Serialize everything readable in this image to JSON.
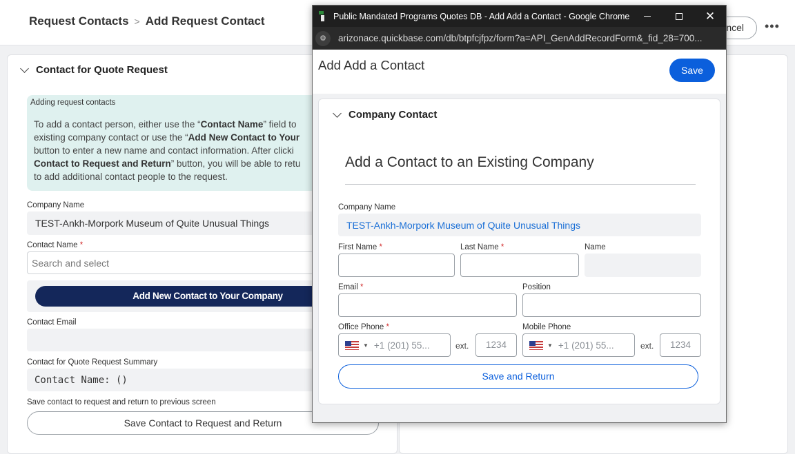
{
  "breadcrumb": {
    "parent": "Request Contacts",
    "separator": ">",
    "current": "Add Request Contact"
  },
  "header_actions": {
    "cancel_label": "ncel",
    "more_label": "•••"
  },
  "left": {
    "section_title": "Contact for Quote Request",
    "info_title": "Adding request contacts",
    "info_lines": [
      [
        "To add a contact person, either use the “",
        "Contact Name",
        "” field to"
      ],
      [
        "existing company contact or use the “",
        "Add New Contact to Your",
        ""
      ],
      [
        "button to enter a new name and contact information. After clicki",
        "",
        ""
      ],
      [
        "",
        "Contact to Request and Return",
        "” button, you will be able to retu"
      ],
      [
        "to add additional contact people to the request.",
        "",
        ""
      ]
    ],
    "company_name_label": "Company Name",
    "company_name_value": "TEST-Ankh-Morpork Museum of Quite Unusual Things",
    "contact_name_label": "Contact Name",
    "required_mark": "*",
    "contact_name_placeholder": "Search and select",
    "add_new_contact_label": "Add New Contact to Your Company",
    "contact_email_label": "Contact Email",
    "contact_email_value": "",
    "summary_label": "Contact for Quote Request Summary",
    "summary_value": "Contact Name: ()",
    "save_hint": "Save contact to request and return to previous screen",
    "save_return_label": "Save Contact to Request and Return"
  },
  "popup": {
    "window_title": "Public Mandated Programs Quotes DB - Add Add a Contact - Google Chrome",
    "url": "arizonace.quickbase.com/db/btpfcjfpz/form?a=API_GenAddRecordForm&_fid_28=700...",
    "form_title": "Add Add a Contact",
    "save_label": "Save",
    "section_title": "Company Contact",
    "heading": "Add a Contact to an Existing Company",
    "company_name_label": "Company Name",
    "company_name_value": "TEST-Ankh-Morpork Museum of Quite Unusual Things",
    "first_name_label": "First Name",
    "last_name_label": "Last Name",
    "name_label": "Name",
    "email_label": "Email",
    "position_label": "Position",
    "office_phone_label": "Office Phone",
    "mobile_phone_label": "Mobile Phone",
    "phone_placeholder": "+1 (201) 55...",
    "ext_label": "ext.",
    "ext_placeholder": "1234",
    "required_mark": "*",
    "save_return_label": "Save and Return"
  }
}
